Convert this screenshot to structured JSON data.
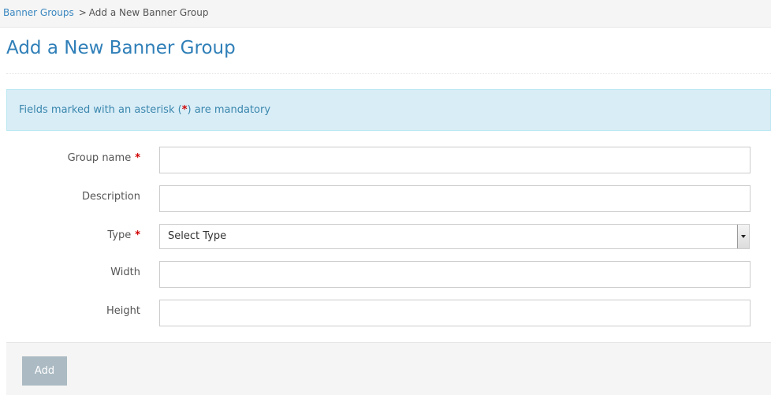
{
  "breadcrumb": {
    "parent_label": "Banner Groups",
    "separator": ">",
    "current_label": "Add a New Banner Group"
  },
  "page": {
    "title": "Add a New Banner Group"
  },
  "notice": {
    "prefix": "Fields marked with an asterisk (",
    "star": "*",
    "suffix": ") are mandatory"
  },
  "form": {
    "required_marker": "*",
    "fields": [
      {
        "label": "Group name",
        "required": true,
        "value": ""
      },
      {
        "label": "Description",
        "required": false,
        "value": ""
      },
      {
        "label": "Type",
        "required": true,
        "selected": "Select Type"
      },
      {
        "label": "Width",
        "required": false,
        "value": ""
      },
      {
        "label": "Height",
        "required": false,
        "value": ""
      }
    ],
    "submit_label": "Add"
  },
  "colors": {
    "link": "#3a87c0",
    "title": "#2f7fb8",
    "alert_bg": "#d9edf7",
    "alert_text": "#3a87ad",
    "required_star": "#d00000",
    "button_bg": "#abbac3"
  }
}
